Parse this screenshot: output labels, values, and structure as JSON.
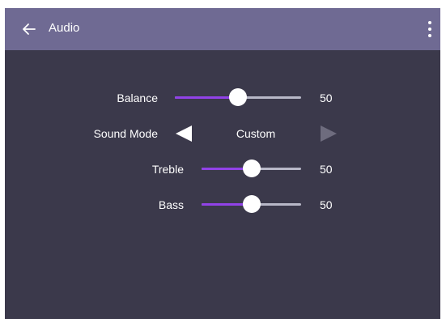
{
  "header": {
    "title": "Audio",
    "back_icon": "arrow-left-icon",
    "menu_icon": "more-vertical-icon"
  },
  "settings": {
    "balance": {
      "label": "Balance",
      "value": "50",
      "level": 0.5
    },
    "sound_mode": {
      "label": "Sound Mode",
      "value": "Custom",
      "left_icon": "triangle-left-icon",
      "right_icon": "triangle-right-icon"
    },
    "treble": {
      "label": "Treble",
      "value": "50",
      "level": 0.5
    },
    "bass": {
      "label": "Bass",
      "value": "50",
      "level": 0.5
    }
  },
  "colors": {
    "header_bg": "#6f6a93",
    "screen_bg": "#3b394b",
    "slider_fill": "#9142e8",
    "slider_track": "#b8b8c8"
  }
}
